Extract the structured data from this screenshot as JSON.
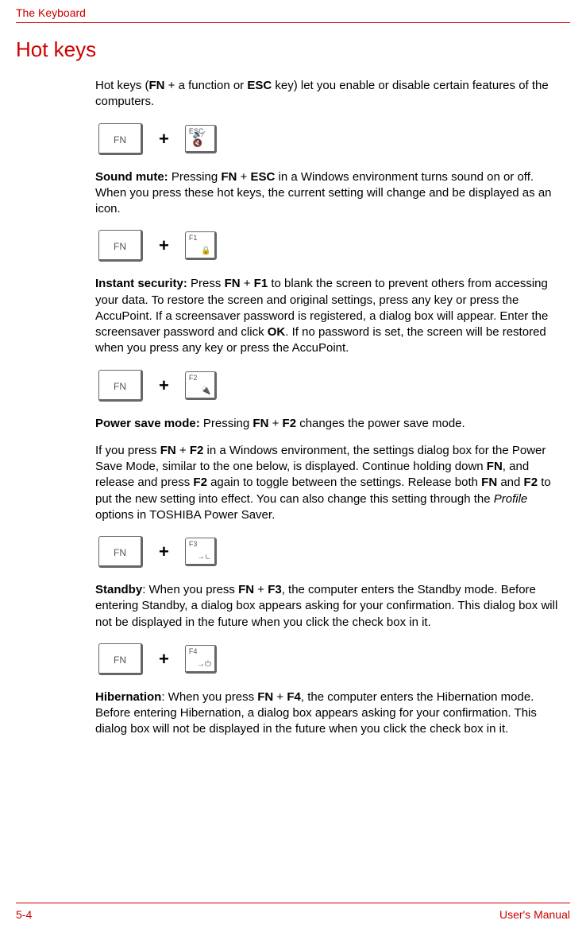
{
  "header": {
    "chapter": "The Keyboard"
  },
  "title": "Hot keys",
  "intro": {
    "pre": "Hot keys (",
    "b1": "FN",
    "mid1": " + a function or ",
    "b2": "ESC",
    "post": " key) let you enable or disable certain features of the computers."
  },
  "combos": {
    "fn_label": "FN",
    "plus": "+",
    "esc": {
      "label": "ESC",
      "icon": "🔈⁄🔇"
    },
    "f1": {
      "label": "F1",
      "icon": "🔒"
    },
    "f2": {
      "label": "F2",
      "icon": "🔌"
    },
    "f3": {
      "label": "F3",
      "icon": "→⏾"
    },
    "f4": {
      "label": "F4",
      "icon": "→⏻"
    }
  },
  "soundmute": {
    "b0": "Sound mute:",
    "t1": " Pressing ",
    "b1": "FN",
    "t2": " + ",
    "b2": "ESC",
    "t3": " in a Windows environment turns sound on or off. When you press these hot keys, the current setting will change and be displayed as an icon."
  },
  "instant": {
    "b0": "Instant security:",
    "t1": " Press ",
    "b1": "FN",
    "t2": " + ",
    "b2": "F1",
    "t3": " to blank the screen to prevent others from accessing your data. To restore the screen and original settings, press any key or press the AccuPoint. If a screensaver password is registered, a dialog box will appear. Enter the screensaver password and click ",
    "b3": "OK",
    "t4": ". If no password is set, the screen will be restored when you press any key or press the AccuPoint."
  },
  "powersave1": {
    "b0": "Power save mode:",
    "t1": " Pressing ",
    "b1": "FN",
    "t2": " + ",
    "b2": "F2",
    "t3": " changes the power save mode."
  },
  "powersave2": {
    "t0": "If you press ",
    "b1": "FN",
    "t1": " + ",
    "b2": "F2",
    "t2": " in a Windows environment, the settings dialog box for the Power Save Mode, similar to the one below, is displayed. Continue holding down ",
    "b3": "FN",
    "t3": ", and release and press ",
    "b4": "F2",
    "t4": " again to toggle between the settings. Release both ",
    "b5": "FN",
    "t5": " and ",
    "b6": "F2",
    "t6": " to put the new setting into effect. You can also change this setting through the ",
    "i1": "Profile",
    "t7": " options in TOSHIBA Power Saver."
  },
  "standby": {
    "b0": "Standby",
    "t1": ": When you press ",
    "b1": "FN",
    "t2": " + ",
    "b2": "F3",
    "t3": ", the computer enters the Standby mode. Before entering Standby, a dialog box appears asking for your confirmation. This dialog box will not be displayed in the future when you click the check box in it."
  },
  "hibernation": {
    "b0": "Hibernation",
    "t1": ": When you press ",
    "b1": "FN",
    "t2": " + ",
    "b2": "F4",
    "t3": ", the computer enters the Hibernation mode. Before entering Hibernation, a dialog box appears asking for your confirmation. This dialog box will not be displayed in the future when you click the check box in it."
  },
  "footer": {
    "page": "5-4",
    "manual": "User's Manual"
  }
}
